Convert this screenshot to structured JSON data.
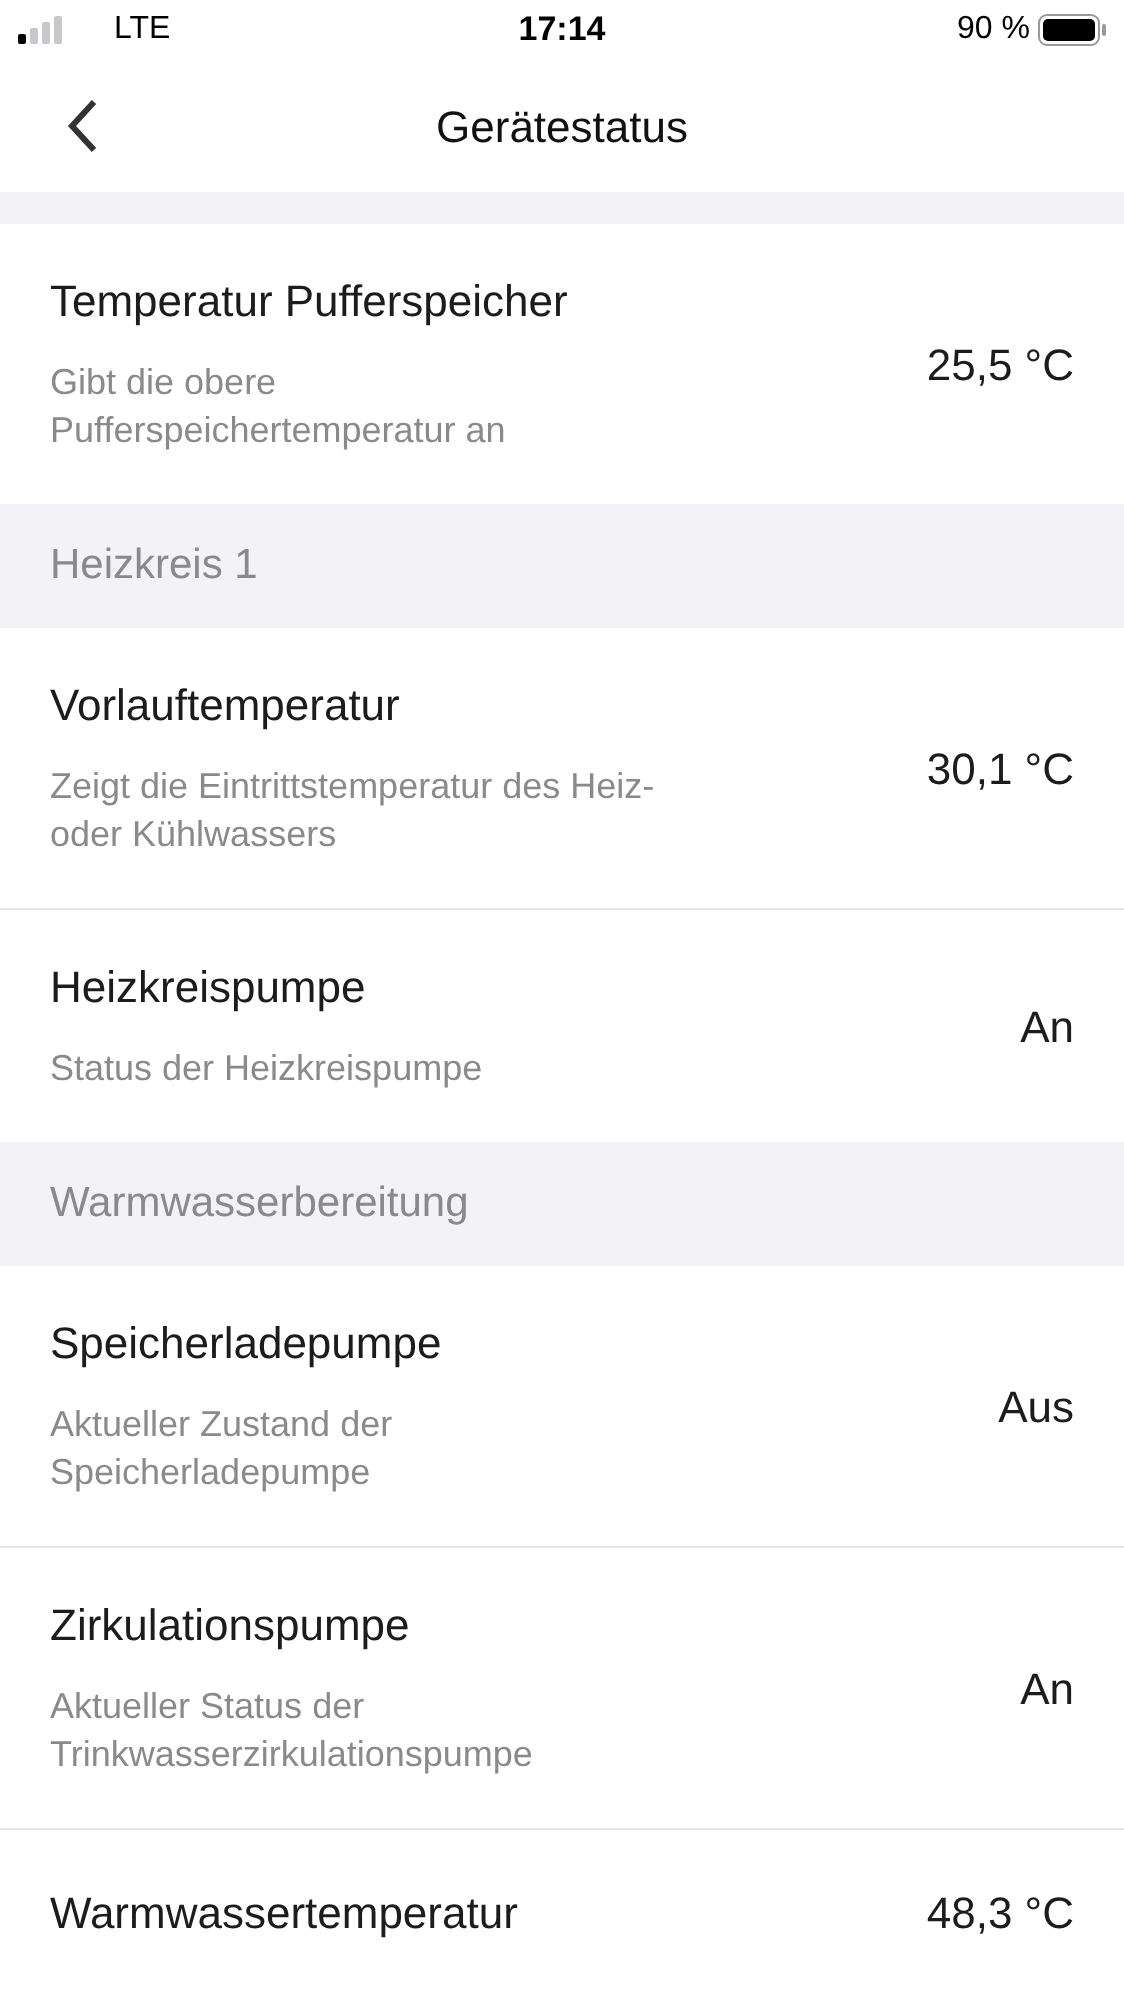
{
  "status_bar": {
    "carrier": "LTE",
    "time": "17:14",
    "battery": "90 %"
  },
  "header": {
    "title": "Gerätestatus"
  },
  "groups": [
    {
      "rows": [
        {
          "title": "Temperatur Pufferspeicher",
          "description": "Gibt die obere Pufferspeichertemperatur an",
          "value": "25,5 °C"
        }
      ]
    },
    {
      "header": "Heizkreis 1",
      "rows": [
        {
          "title": "Vorlauftemperatur",
          "description": "Zeigt die Eintrittstemperatur des Heiz- oder Kühlwassers",
          "value": "30,1 °C"
        },
        {
          "title": "Heizkreispumpe",
          "description": "Status der Heizkreispumpe",
          "value": "An"
        }
      ]
    },
    {
      "header": "Warmwasserbereitung",
      "rows": [
        {
          "title": "Speicherladepumpe",
          "description": "Aktueller Zustand der Speicherladepumpe",
          "value": "Aus"
        },
        {
          "title": "Zirkulationspumpe",
          "description": "Aktueller Status der Trinkwasserzirkulationspumpe",
          "value": "An"
        },
        {
          "title": "Warmwassertemperatur",
          "value": "48,3 °C"
        }
      ]
    }
  ]
}
